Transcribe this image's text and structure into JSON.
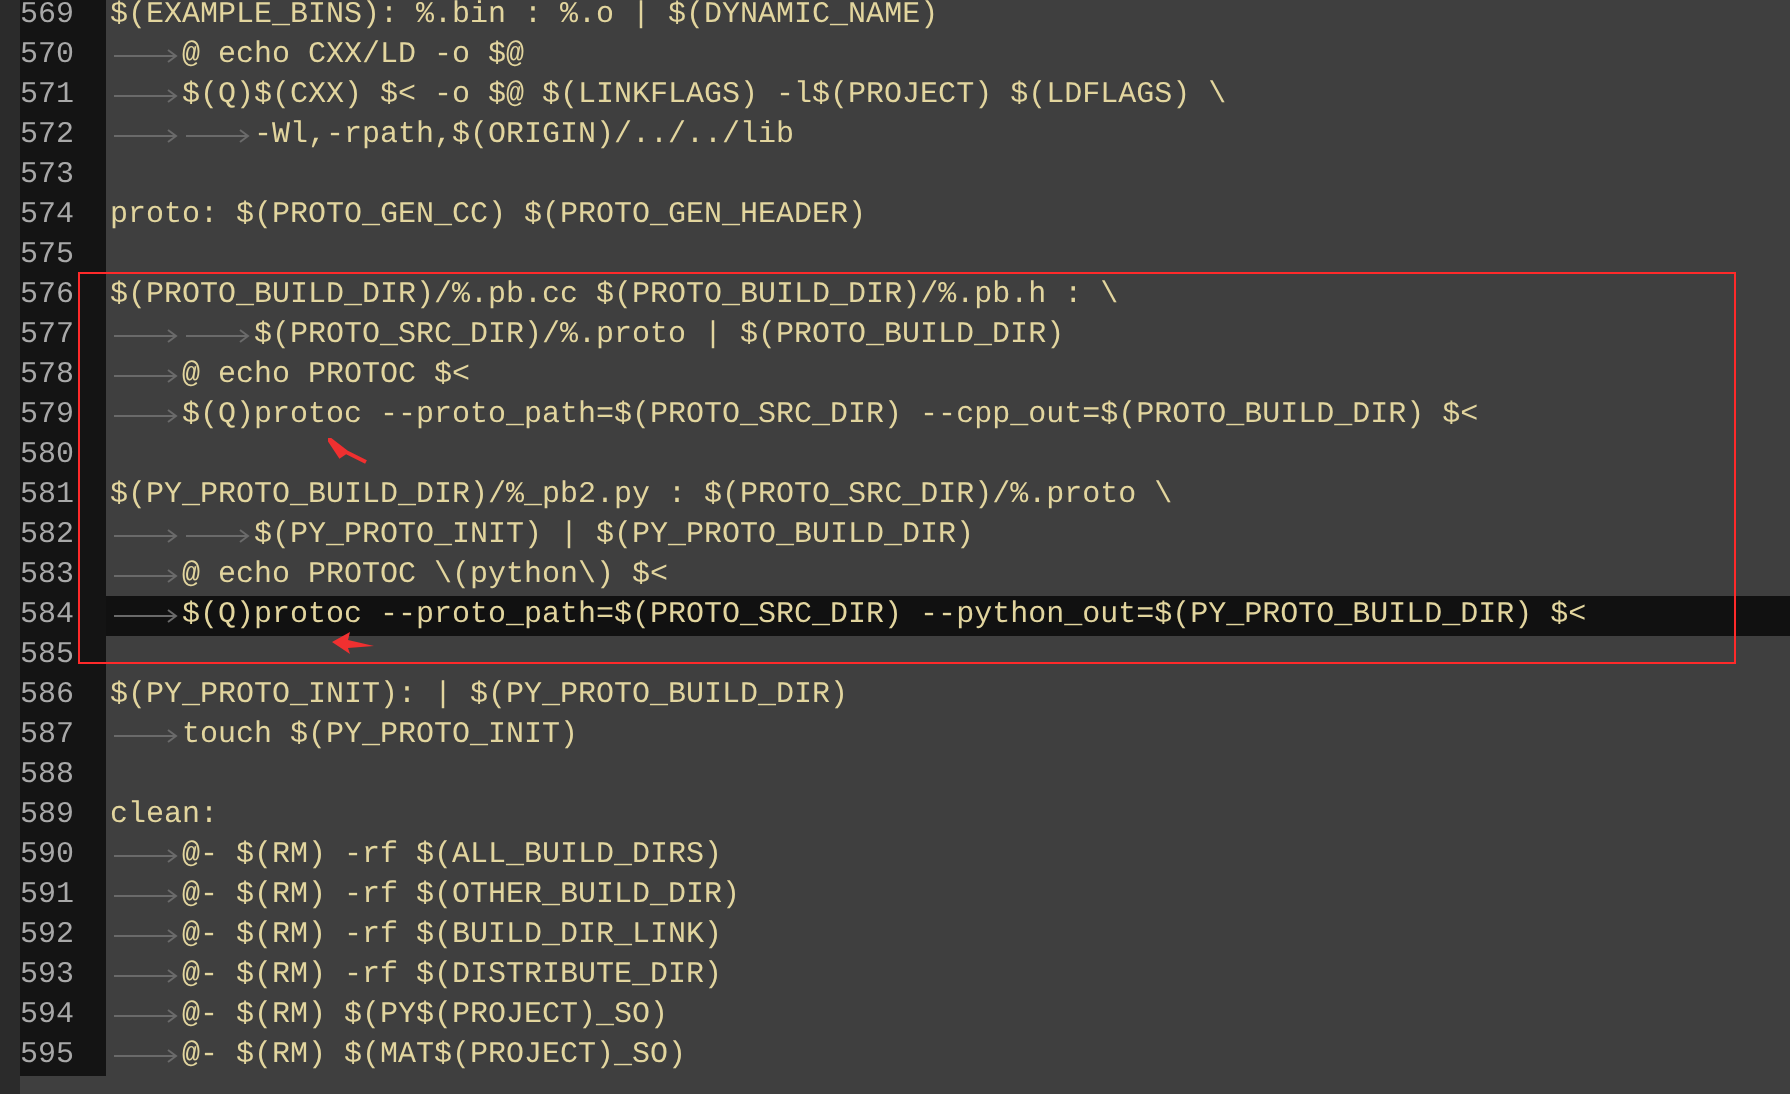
{
  "editor": {
    "lines": [
      {
        "number": "569",
        "text": "$(EXAMPLE_BINS): %.bin : %.o | $(DYNAMIC_NAME)",
        "current": false
      },
      {
        "number": "570",
        "indent": [
          {
            "kind": "tab"
          }
        ],
        "text": "@ echo CXX/LD -o $@",
        "current": false
      },
      {
        "number": "571",
        "indent": [
          {
            "kind": "tab"
          }
        ],
        "text": "$(Q)$(CXX) $< -o $@ $(LINKFLAGS) -l$(PROJECT) $(LDFLAGS) \\",
        "current": false
      },
      {
        "number": "572",
        "indent": [
          {
            "kind": "tab"
          },
          {
            "kind": "tab"
          }
        ],
        "text": "-Wl,-rpath,$(ORIGIN)/../../lib",
        "current": false
      },
      {
        "number": "573",
        "current": false
      },
      {
        "number": "574",
        "text": "proto: $(PROTO_GEN_CC) $(PROTO_GEN_HEADER)",
        "current": false
      },
      {
        "number": "575",
        "current": false
      },
      {
        "number": "576",
        "text": "$(PROTO_BUILD_DIR)/%.pb.cc $(PROTO_BUILD_DIR)/%.pb.h : \\",
        "current": false
      },
      {
        "number": "577",
        "indent": [
          {
            "kind": "tab"
          },
          {
            "kind": "tab"
          }
        ],
        "text": "$(PROTO_SRC_DIR)/%.proto | $(PROTO_BUILD_DIR)",
        "current": false
      },
      {
        "number": "578",
        "indent": [
          {
            "kind": "tab"
          }
        ],
        "text": "@ echo PROTOC $<",
        "current": false
      },
      {
        "number": "579",
        "indent": [
          {
            "kind": "tab"
          }
        ],
        "text": "$(Q)protoc --proto_path=$(PROTO_SRC_DIR) --cpp_out=$(PROTO_BUILD_DIR) $<",
        "current": false
      },
      {
        "number": "580",
        "current": false
      },
      {
        "number": "581",
        "text": "$(PY_PROTO_BUILD_DIR)/%_pb2.py : $(PROTO_SRC_DIR)/%.proto \\",
        "current": false
      },
      {
        "number": "582",
        "indent": [
          {
            "kind": "tab"
          },
          {
            "kind": "tab"
          }
        ],
        "text": "$(PY_PROTO_INIT) | $(PY_PROTO_BUILD_DIR)",
        "current": false
      },
      {
        "number": "583",
        "indent": [
          {
            "kind": "tab"
          }
        ],
        "text": "@ echo PROTOC \\(python\\) $<",
        "current": false
      },
      {
        "number": "584",
        "indent": [
          {
            "kind": "tab"
          }
        ],
        "text": "$(Q)protoc --proto_path=$(PROTO_SRC_DIR) --python_out=$(PY_PROTO_BUILD_DIR) $<",
        "current": true
      },
      {
        "number": "585",
        "current": false
      },
      {
        "number": "586",
        "text": "$(PY_PROTO_INIT): | $(PY_PROTO_BUILD_DIR)",
        "current": false
      },
      {
        "number": "587",
        "indent": [
          {
            "kind": "tab"
          }
        ],
        "text": "touch $(PY_PROTO_INIT)",
        "current": false
      },
      {
        "number": "588",
        "current": false
      },
      {
        "number": "589",
        "text": "clean:",
        "current": false
      },
      {
        "number": "590",
        "indent": [
          {
            "kind": "tab"
          }
        ],
        "text": "@- $(RM) -rf $(ALL_BUILD_DIRS)",
        "current": false
      },
      {
        "number": "591",
        "indent": [
          {
            "kind": "tab"
          }
        ],
        "text": "@- $(RM) -rf $(OTHER_BUILD_DIR)",
        "current": false
      },
      {
        "number": "592",
        "indent": [
          {
            "kind": "tab"
          }
        ],
        "text": "@- $(RM) -rf $(BUILD_DIR_LINK)",
        "current": false
      },
      {
        "number": "593",
        "indent": [
          {
            "kind": "tab"
          }
        ],
        "text": "@- $(RM) -rf $(DISTRIBUTE_DIR)",
        "current": false
      },
      {
        "number": "594",
        "indent": [
          {
            "kind": "tab"
          }
        ],
        "text": "@- $(RM) $(PY$(PROJECT)_SO)",
        "current": false
      },
      {
        "number": "595",
        "indent": [
          {
            "kind": "tab"
          }
        ],
        "text": "@- $(RM) $(MAT$(PROJECT)_SO)",
        "current": false
      }
    ]
  }
}
